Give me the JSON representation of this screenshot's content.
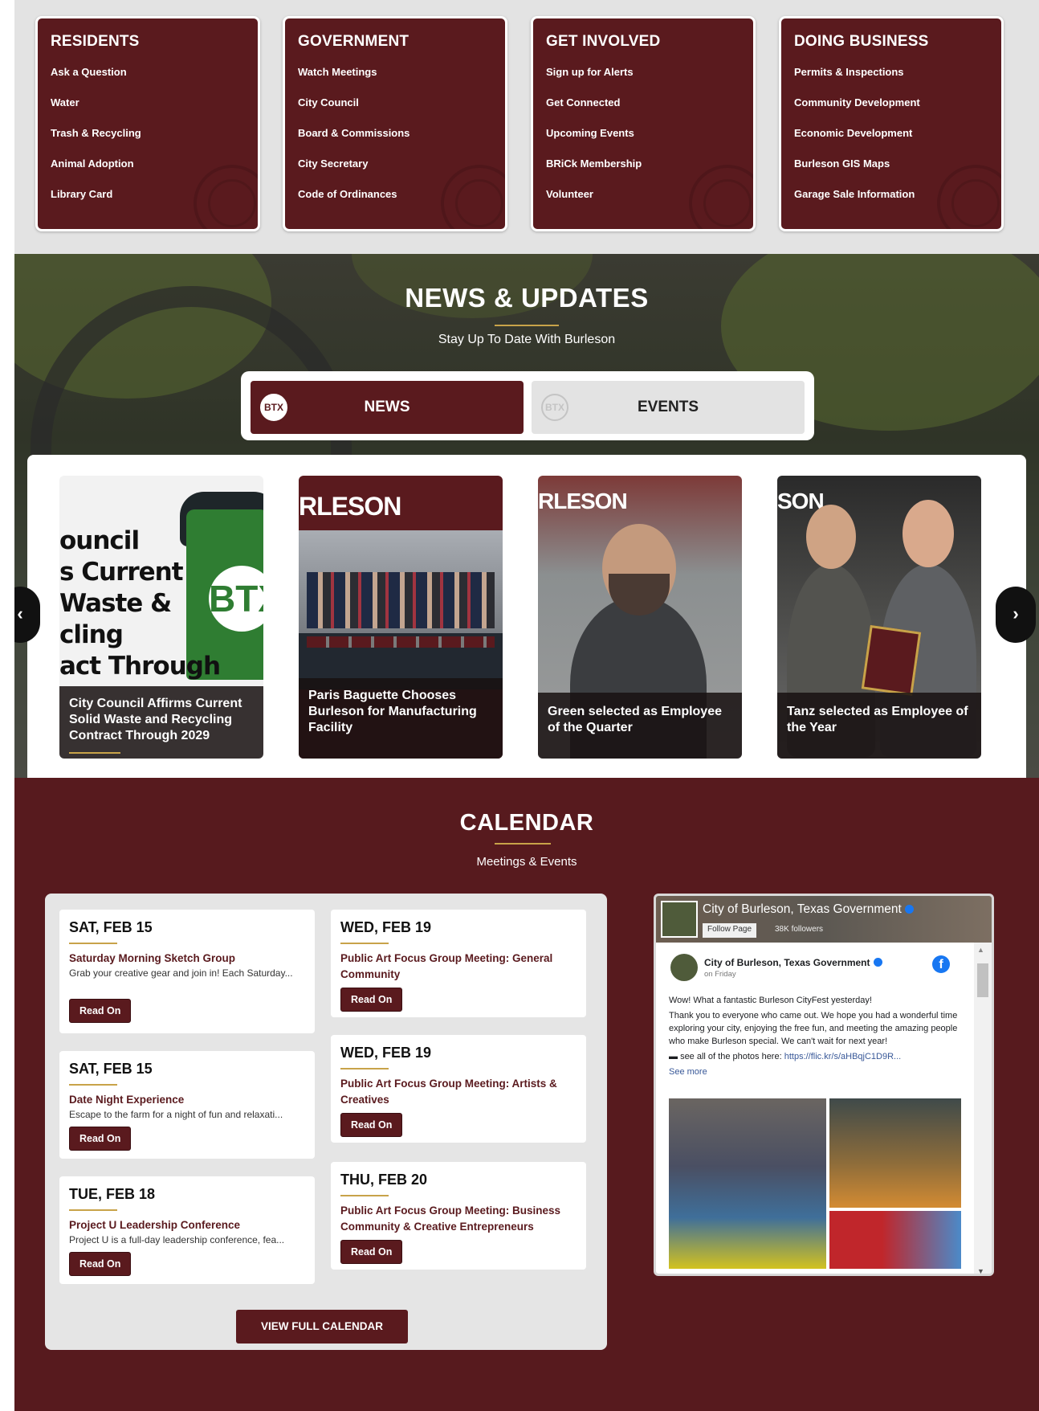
{
  "quick_links": [
    {
      "title": "RESIDENTS",
      "items": [
        "Ask a Question",
        "Water",
        "Trash & Recycling",
        "Animal Adoption",
        "Library Card"
      ]
    },
    {
      "title": "GOVERNMENT",
      "items": [
        "Watch Meetings",
        "City Council",
        "Board & Commissions",
        "City Secretary",
        "Code of Ordinances"
      ]
    },
    {
      "title": "GET INVOLVED",
      "items": [
        "Sign up for Alerts",
        "Get Connected",
        "Upcoming Events",
        "BRiCk Membership",
        "Volunteer"
      ]
    },
    {
      "title": "DOING BUSINESS",
      "items": [
        "Permits & Inspections",
        "Community Development",
        "Economic Development",
        "Burleson GIS Maps",
        "Garage Sale Information"
      ]
    }
  ],
  "news": {
    "title": "NEWS & UPDATES",
    "subtitle": "Stay Up To Date With Burleson",
    "tabs": [
      {
        "label": "NEWS",
        "logo": "BTX"
      },
      {
        "label": "EVENTS",
        "logo": "BTX"
      }
    ],
    "prev_label": "‹",
    "next_label": "›",
    "cards": [
      {
        "caption": "City Council Affirms Current Solid Waste and Recycling Contract Through 2029",
        "art_text": [
          "ouncil",
          "s Current",
          "Waste &",
          "cling",
          "act Through"
        ],
        "art_logo": "BTX"
      },
      {
        "caption": "Paris Baguette Chooses Burleson for Manufacturing Facility",
        "art_text": "RLESON"
      },
      {
        "caption": "Green selected as Employee of the Quarter",
        "art_text": "RLESON"
      },
      {
        "caption": "Tanz selected as Employee of the Year",
        "art_text": "SON"
      }
    ]
  },
  "calendar": {
    "title": "CALENDAR",
    "subtitle": "Meetings & Events",
    "button_label": "Read On",
    "view_all_label": "VIEW FULL CALENDAR",
    "events_left": [
      {
        "date": "SAT, FEB 15",
        "title": "Saturday Morning Sketch Group",
        "desc": "Grab your creative gear and join in! Each Saturday..."
      },
      {
        "date": "SAT, FEB 15",
        "title": "Date Night Experience",
        "desc": "Escape to the farm for a night of fun and relaxati..."
      },
      {
        "date": "TUE, FEB 18",
        "title": "Project U Leadership Conference",
        "desc": "Project U is a full-day leadership conference, fea..."
      }
    ],
    "events_right": [
      {
        "date": "WED, FEB 19",
        "title": "Public Art Focus Group Meeting: General Community"
      },
      {
        "date": "WED, FEB 19",
        "title": "Public Art Focus Group Meeting: Artists & Creatives"
      },
      {
        "date": "THU, FEB 20",
        "title": "Public Art Focus Group Meeting: Business Community & Creative Entrepreneurs"
      }
    ]
  },
  "facebook": {
    "page_name": "City of Burleson, Texas Government",
    "follow_label": "Follow Page",
    "followers": "38K followers",
    "post_author": "City of Burleson, Texas Government",
    "post_time": "on Friday",
    "post_lines": [
      "Wow! What a fantastic Burleson CityFest yesterday!",
      "Thank you to everyone who came out. We hope you had a wonderful time exploring your city, enjoying the free fun, and meeting the amazing people who make Burleson special. We can't wait for next year!"
    ],
    "photos_prefix": "see all of the photos here: ",
    "photos_link": "https://flic.kr/s/aHBqjC1D9R...",
    "see_more": "See more",
    "logo_glyph": "f"
  },
  "colors": {
    "maroon": "#5a1a1e",
    "gold": "#c8a349",
    "facebook_blue": "#1877f2"
  }
}
